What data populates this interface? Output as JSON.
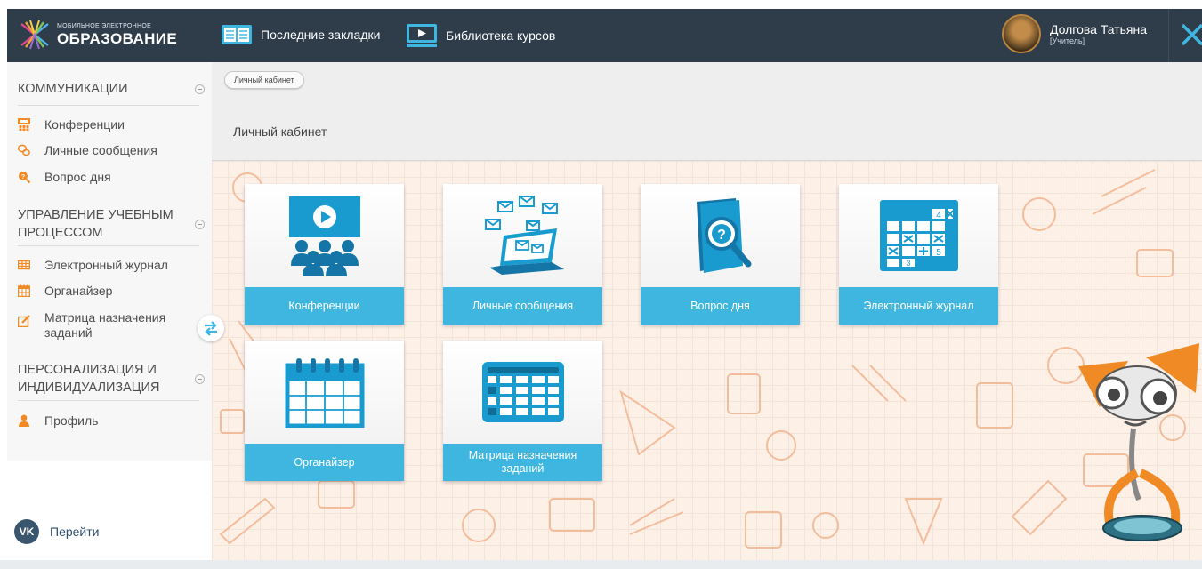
{
  "header": {
    "logo_small": "МОБИЛЬНОЕ ЭЛЕКТРОННОЕ",
    "logo_big": "ОБРАЗОВАНИЕ",
    "nav": [
      {
        "label": "Последние закладки",
        "icon": "book-icon"
      },
      {
        "label": "Библиотека курсов",
        "icon": "video-library-icon"
      }
    ],
    "user": {
      "name": "Долгова Татьяна",
      "role": "[Учитель]"
    }
  },
  "sidebar": {
    "sections": [
      {
        "title": "КОММУНИКАЦИИ",
        "items": [
          {
            "label": "Конференции",
            "icon": "conference-icon"
          },
          {
            "label": "Личные сообщения",
            "icon": "messages-icon"
          },
          {
            "label": "Вопрос дня",
            "icon": "question-search-icon"
          }
        ]
      },
      {
        "title": "УПРАВЛЕНИЕ УЧЕБНЫМ ПРОЦЕССОМ",
        "items": [
          {
            "label": "Электронный журнал",
            "icon": "journal-icon"
          },
          {
            "label": "Органайзер",
            "icon": "calendar-icon"
          },
          {
            "label": "Матрица назначения заданий",
            "icon": "edit-icon"
          }
        ]
      },
      {
        "title": "ПЕРСОНАЛИЗАЦИЯ И ИНДИВИДУАЛИЗАЦИЯ",
        "items": [
          {
            "label": "Профиль",
            "icon": "user-icon"
          }
        ]
      }
    ],
    "vk": {
      "badge": "VK",
      "label": "Перейти"
    }
  },
  "main": {
    "breadcrumb": "Личный кабинет",
    "title": "Личный кабинет",
    "tiles": [
      {
        "label": "Конференции",
        "icon": "conference-icon"
      },
      {
        "label": "Личные сообщения",
        "icon": "messages-laptop-icon"
      },
      {
        "label": "Вопрос дня",
        "icon": "question-book-icon"
      },
      {
        "label": "Электронный журнал",
        "icon": "journal-grid-icon"
      },
      {
        "label": "Органайзер",
        "icon": "calendar-icon"
      },
      {
        "label": "Матрица назначения заданий",
        "icon": "matrix-table-icon"
      }
    ]
  },
  "colors": {
    "topbar": "#2f3d4b",
    "accent": "#3fb6df",
    "orange": "#f08a24",
    "background": "#fdf0e7"
  }
}
